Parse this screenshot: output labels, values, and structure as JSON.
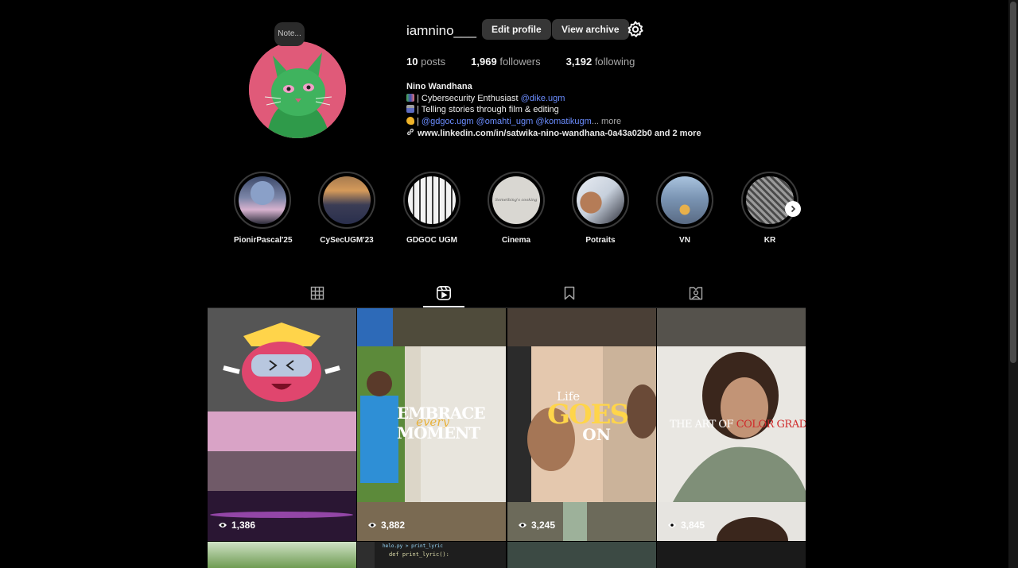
{
  "profile": {
    "note": "Note...",
    "username": "iamnino___",
    "edit_profile": "Edit profile",
    "view_archive": "View archive",
    "stats": {
      "posts_count": "10",
      "posts_label": "posts",
      "followers_count": "1,969",
      "followers_label": "followers",
      "following_count": "3,192",
      "following_label": "following"
    },
    "bio": {
      "name": "Nino Wandhana",
      "line1_text": "| Cybersecurity Enthusiast ",
      "line1_mention": "@dike.ugm",
      "line2_text": "| Telling stories through film & editing",
      "line3_prefix": "| ",
      "line3_mention1": "@gdgoc.ugm",
      "line3_mention2": "@omahti_ugm",
      "line3_mention3": "@komatikugm",
      "line3_more": "... more",
      "link": "www.linkedin.com/in/satwika-nino-wandhana-0a43a02b0 and 2 more"
    }
  },
  "highlights": [
    {
      "label": "PionirPascal'25"
    },
    {
      "label": "CySecUGM'23"
    },
    {
      "label": "GDGOC UGM"
    },
    {
      "label": "Cinema",
      "inner_text": "Something's cooking"
    },
    {
      "label": "Potraits"
    },
    {
      "label": "VN"
    },
    {
      "label": "KR"
    }
  ],
  "tabs": [
    "posts-grid",
    "reels",
    "saved",
    "tagged"
  ],
  "active_tab": "reels",
  "reels": [
    {
      "views": "1,386"
    },
    {
      "views": "3,882",
      "overlay": {
        "line1": "EMBRACE",
        "line2": "every",
        "line3": "MOMENT"
      }
    },
    {
      "views": "3,245",
      "overlay": {
        "line1": "Life",
        "line2": "GOES",
        "line3": "ON"
      }
    },
    {
      "views": "3,845",
      "overlay": {
        "line1": "THE ART OF",
        "line2": "COLOR GRADING"
      }
    }
  ],
  "code_snippet": {
    "line1": "helo.py > print_lyric",
    "line2": "def print_lyric():"
  }
}
